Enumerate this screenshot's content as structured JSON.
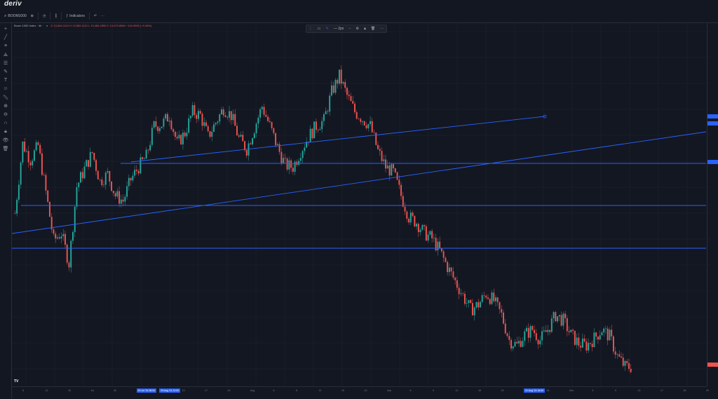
{
  "app": {
    "logo": "deriv"
  },
  "toolbar": {
    "symbol": "BOOM1000",
    "indicators_label": "Indicators"
  },
  "legend": {
    "title": "Boom 1000 Index · 4h ·",
    "ohlc": "O 13,564.1110  H 13,589.1110  L 13,465.4950  C 13,479.8560  −104.9500 (−0.46%)"
  },
  "float_toolbar": {
    "width_label": "2px"
  },
  "colors": {
    "background": "#131722",
    "up": "#26a69a",
    "down": "#ef5350",
    "drawing": "#2962ff"
  },
  "icons": [
    "crosshair-icon",
    "trendline-icon",
    "fib-icon",
    "pattern-icon",
    "forecast-icon",
    "brush-icon",
    "text-icon",
    "emoji-icon",
    "ruler-icon",
    "zoom-in-icon",
    "zoom-out-icon",
    "magnet-icon",
    "lock-icon",
    "eye-icon",
    "trash-icon"
  ],
  "chart_data": {
    "type": "candlestick",
    "title": "Boom 1000 Index",
    "interval": "4h",
    "close": [
      14.23,
      14.62,
      14.53,
      14.61,
      14.35,
      14.08,
      14.12,
      13.95,
      14.38,
      14.48,
      14.57,
      14.41,
      14.45,
      14.33,
      14.3,
      14.42,
      14.49,
      14.55,
      14.72,
      14.73,
      14.78,
      14.62,
      14.68,
      14.8,
      14.78,
      14.66,
      14.74,
      14.82,
      14.78,
      14.65,
      14.59,
      14.71,
      14.83,
      14.72,
      14.6,
      14.5,
      14.49,
      14.58,
      14.66,
      14.72,
      14.75,
      14.91,
      15.0,
      14.89,
      14.8,
      14.76,
      14.72,
      14.58,
      14.49,
      14.46,
      14.33,
      14.21,
      14.18,
      14.12,
      14.09,
      14.02,
      13.93,
      13.85,
      13.77,
      13.69,
      13.72,
      13.78,
      13.74,
      13.66,
      13.52,
      13.49,
      13.55,
      13.58,
      13.52,
      13.58,
      13.66,
      13.63,
      13.55,
      13.5,
      13.49,
      13.53,
      13.58,
      13.54,
      13.43,
      13.37
    ],
    "xlabels": [
      "8",
      "12",
      "15",
      "Jul",
      "25",
      "29 Jul '24 08:00",
      "29 Aug '24 12:00",
      "13",
      "17",
      "20",
      "Aug",
      "5",
      "8",
      "12",
      "15",
      "19",
      "Sep",
      "5",
      "9",
      "12",
      "16",
      "19",
      "21 Aug '24 16:00",
      "26",
      "Dec",
      "5",
      "9",
      "12",
      "17",
      "26",
      "29"
    ]
  }
}
